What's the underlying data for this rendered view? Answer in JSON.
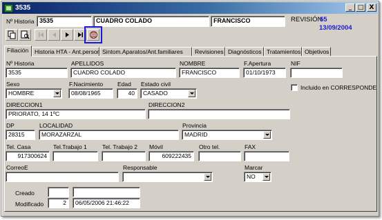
{
  "window": {
    "title": "3535",
    "controls": {
      "minimize": "_",
      "maximize": "□",
      "close": "X"
    }
  },
  "header": {
    "nhistoria_label": "Nº Historia",
    "nhistoria_value": "3535",
    "apellidos_value": "CUADRO COLADO",
    "nombre_value": "FRANCISCO",
    "revision_label": "REVISIÓN",
    "revision_number": "55",
    "revision_date": "13/09/2004"
  },
  "toolbar": {
    "icons": [
      "copy-record-icon",
      "print-preview-icon",
      "first-record-icon",
      "previous-record-icon",
      "next-record-icon",
      "last-record-icon",
      "refresh-icon"
    ]
  },
  "tabs": [
    {
      "label": "Filiación",
      "active": true
    },
    {
      "label": "Historia HTA - Ant.personales",
      "active": false
    },
    {
      "label": "Sintom.Aparatos/Ant.familiares",
      "active": false
    },
    {
      "label": "Revisiones",
      "active": false
    },
    {
      "label": "Diagnósticos",
      "active": false
    },
    {
      "label": "Tratamientos",
      "active": false
    },
    {
      "label": "Objetivos",
      "active": false
    }
  ],
  "form": {
    "nhistoria": {
      "label": "Nº Historia",
      "value": "3535"
    },
    "apellidos": {
      "label": "APELLIDOS",
      "value": "CUADRO COLADO"
    },
    "nombre": {
      "label": "NOMBRE",
      "value": "FRANCISCO"
    },
    "fapertura": {
      "label": "F.Apertura",
      "value": "01/10/1973"
    },
    "nif": {
      "label": "NIF",
      "value": ""
    },
    "sexo": {
      "label": "Sexo",
      "value": "HOMBRE"
    },
    "fnacimiento": {
      "label": "F.Nacimiento",
      "value": "08/08/1965"
    },
    "edad": {
      "label": "Edad",
      "value": "40"
    },
    "estado_civil": {
      "label": "Estado civil",
      "value": "CASADO"
    },
    "corresponde": {
      "label": "Incluido en CORRESPONDE",
      "checked": false
    },
    "direccion1": {
      "label": "DIRECCION1",
      "value": "PRIORATO, 14 1ºC"
    },
    "direccion2": {
      "label": "DIRECCION2",
      "value": ""
    },
    "dp": {
      "label": "DP",
      "value": "28315"
    },
    "localidad": {
      "label": "LOCALIDAD",
      "value": "MORAZARZAL"
    },
    "provincia": {
      "label": "Provincia",
      "value": "MADRID"
    },
    "tel_casa": {
      "label": "Tel. Casa",
      "value": "917300624"
    },
    "tel_trabajo1": {
      "label": "Tel.Trabajo 1",
      "value": ""
    },
    "tel_trabajo2": {
      "label": "Tel. Trabajo 2",
      "value": ""
    },
    "movil": {
      "label": "Móvil",
      "value": "609222435"
    },
    "otro_tel": {
      "label": "Otro tel.",
      "value": ""
    },
    "fax": {
      "label": "FAX",
      "value": ""
    },
    "correo": {
      "label": "CorreoE",
      "value": ""
    },
    "responsable": {
      "label": "Responsable",
      "value": ""
    },
    "marcar": {
      "label": "Marcar",
      "value": "NO"
    },
    "creado": {
      "label": "Creado",
      "count": "",
      "date": ""
    },
    "modificado": {
      "label": "Modificado",
      "count": "2",
      "date": "06/05/2006 21:46:22"
    }
  }
}
